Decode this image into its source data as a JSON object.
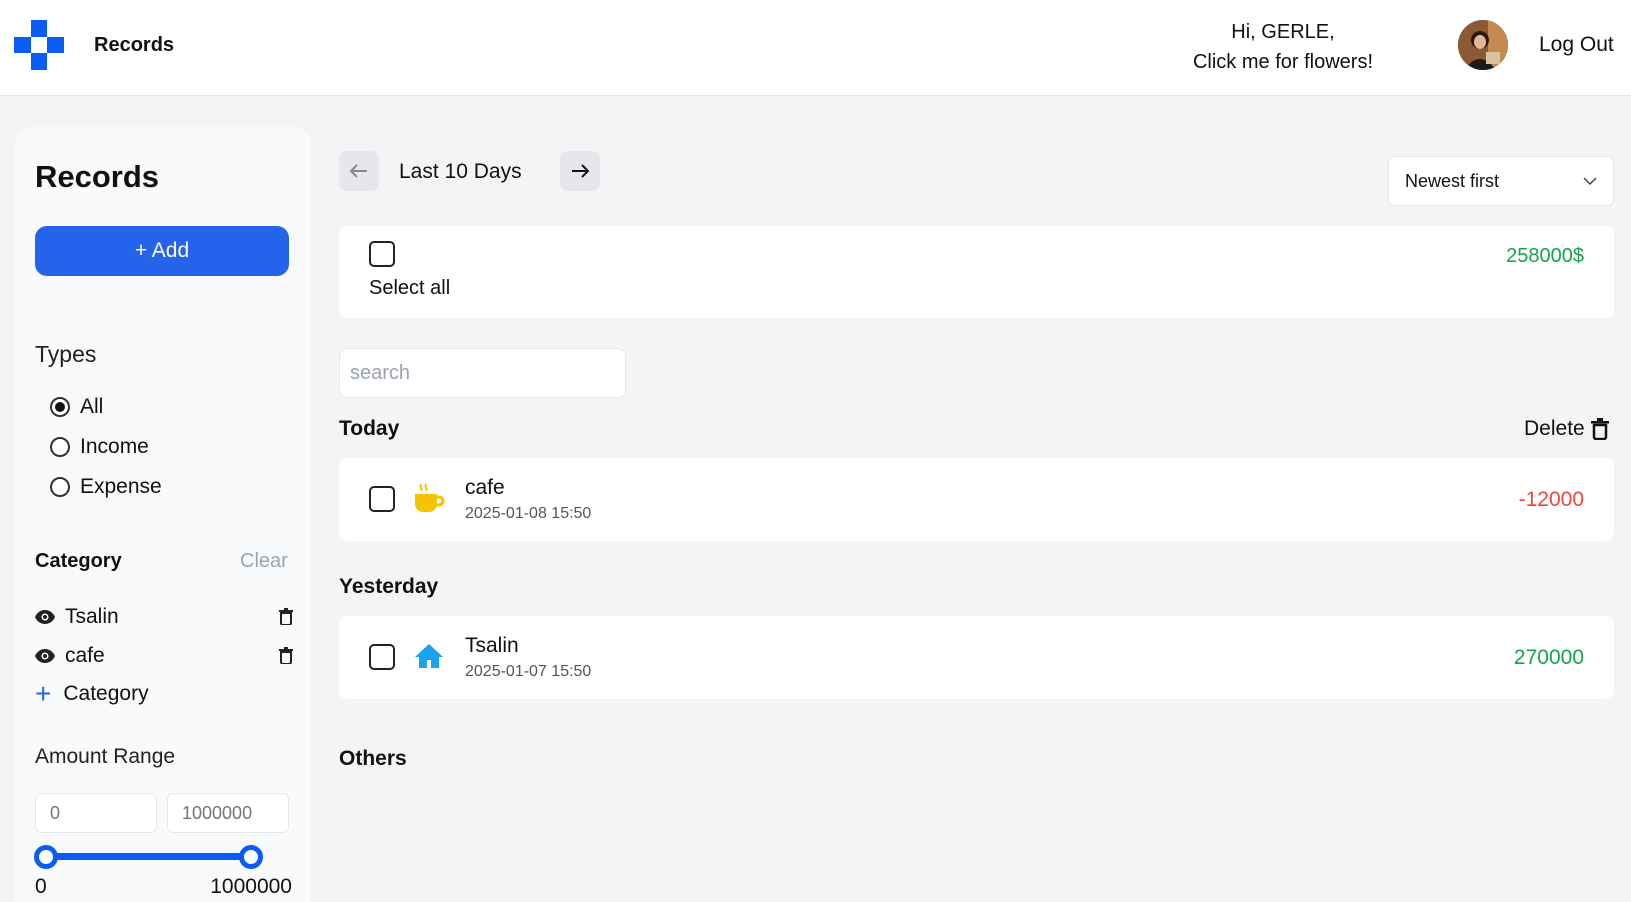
{
  "header": {
    "brand": "Records",
    "greeting_line1": "Hi, GERLE,",
    "greeting_line2": "Click me for flowers!",
    "logout": "Log Out"
  },
  "sidebar": {
    "title": "Records",
    "add_label": "+ Add",
    "types_title": "Types",
    "types": [
      "All",
      "Income",
      "Expense"
    ],
    "selected_type": "All",
    "category_title": "Category",
    "category_clear": "Clear",
    "categories": [
      "Tsalin",
      "cafe"
    ],
    "add_category_label": "Category",
    "range_title": "Amount Range",
    "range_min_placeholder": "0",
    "range_max_placeholder": "1000000",
    "range_min_label": "0",
    "range_max_label": "1000000",
    "range_min_fraction": 0,
    "range_max_fraction": 1
  },
  "main": {
    "period": "Last 10 Days",
    "sort_label": "Newest first",
    "select_all": "Select all",
    "total": "258000$",
    "search_placeholder": "search",
    "delete_label": "Delete",
    "sections": [
      {
        "title": "Today",
        "records": [
          {
            "name": "cafe",
            "date": "2025-01-08 15:50",
            "amount": "-12000",
            "icon": "coffee-cup-icon"
          }
        ]
      },
      {
        "title": "Yesterday",
        "records": [
          {
            "name": "Tsalin",
            "date": "2025-01-07 15:50",
            "amount": "270000",
            "icon": "house-icon"
          }
        ]
      },
      {
        "title": "Others",
        "records": []
      }
    ]
  },
  "colors": {
    "accent": "#2563eb",
    "positive": "#16a34a",
    "negative": "#ef4444",
    "total": "#16a34a"
  }
}
